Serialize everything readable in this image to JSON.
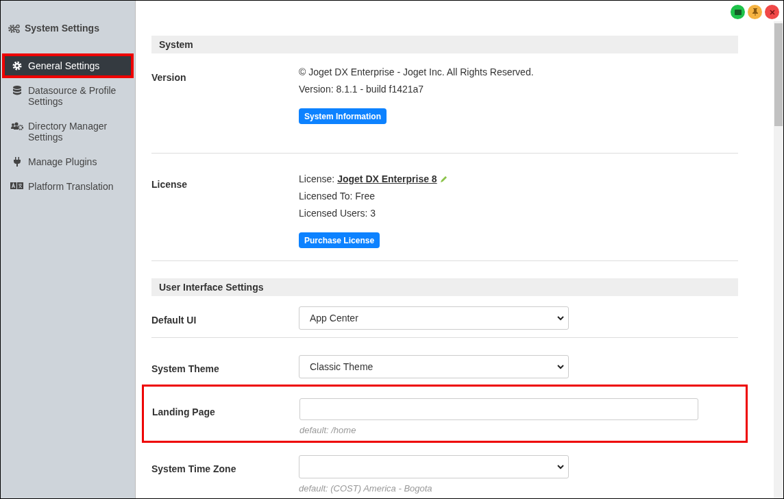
{
  "sidebar": {
    "title": "System Settings",
    "items": [
      {
        "label": "General Settings",
        "selected": true,
        "highlighted": true
      },
      {
        "label": "Datasource & Profile Settings",
        "selected": false,
        "highlighted": false
      },
      {
        "label": "Directory Manager Settings",
        "selected": false,
        "highlighted": false
      },
      {
        "label": "Manage Plugins",
        "selected": false,
        "highlighted": false
      },
      {
        "label": "Platform Translation",
        "selected": false,
        "highlighted": false
      }
    ]
  },
  "sections": [
    {
      "title": "System",
      "rows": [
        {
          "kind": "info",
          "label": "Version",
          "lines": [
            {
              "text": "© Joget DX Enterprise - Joget Inc. All Rights Reserved."
            },
            {
              "text": "Version: 8.1.1 - build f1421a7"
            }
          ],
          "button": "System Information"
        },
        {
          "kind": "info",
          "label": "License",
          "lines": [
            {
              "text": "License:",
              "link": "Joget DX Enterprise 8"
            },
            {
              "text": "Licensed To: Free"
            },
            {
              "text": "Licensed Users: 3"
            }
          ],
          "button": "Purchase License"
        }
      ]
    },
    {
      "title": "User Interface Settings",
      "rows": [
        {
          "kind": "select",
          "label": "Default UI",
          "value": "App Center",
          "highlighted": false
        },
        {
          "kind": "select",
          "label": "System Theme",
          "value": "Classic Theme",
          "highlighted": false
        },
        {
          "kind": "text",
          "label": "Landing Page",
          "hint": "default: /home",
          "highlighted": true
        },
        {
          "kind": "select",
          "label": "System Time Zone",
          "hint": "default: (COST) America - Bogota",
          "highlighted": false
        }
      ]
    }
  ]
}
